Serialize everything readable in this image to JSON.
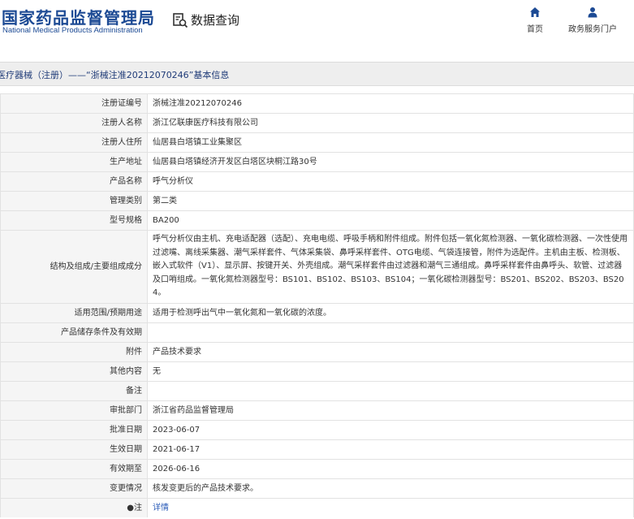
{
  "header": {
    "logo_cn": "国家药品监督管理局",
    "logo_en": "National Medical Products Administration",
    "query_label": "数据查询",
    "nav": [
      {
        "label": "首页",
        "icon": "home-icon"
      },
      {
        "label": "政务服务门户",
        "icon": "user-icon"
      }
    ]
  },
  "title": "医疗器械（注册）——“浙械注准20212070246”基本信息",
  "colors": {
    "brand": "#1c4a94",
    "key_bg": "#f5f5f5",
    "title_bg": "#eeeeee",
    "link": "#2a5bb8"
  },
  "rows": [
    {
      "label": "注册证编号",
      "value": "浙械注准20212070246"
    },
    {
      "label": "注册人名称",
      "value": "浙江亿联康医疗科技有限公司"
    },
    {
      "label": "注册人住所",
      "value": "仙居县白塔镇工业集聚区"
    },
    {
      "label": "生产地址",
      "value": "仙居县白塔镇经济开发区白塔区块桐江路30号"
    },
    {
      "label": "产品名称",
      "value": "呼气分析仪"
    },
    {
      "label": "管理类别",
      "value": "第二类"
    },
    {
      "label": "型号规格",
      "value": "BA200"
    },
    {
      "label": "结构及组成/主要组成成分",
      "value": "呼气分析仪由主机、充电适配器（选配）、充电电缆、呼吸手柄和附件组成。附件包括一氧化氮检测器、一氧化碳检测器、一次性使用过滤嘴、离线采集器、潮气采样套件、气体采集袋、鼻呼采样套件、OTG电缆、气袋连接管，附件为选配件。主机由主板、检测板、嵌入式软件（V1）、显示屏、按键开关、外壳组成。潮气采样套件由过滤器和潮气三通组成。鼻呼采样套件由鼻呼头、软管、过滤器及口哨组成。一氧化氮检测器型号：BS101、BS102、BS103、BS104；一氧化碳检测器型号：BS201、BS202、BS203、BS204。"
    },
    {
      "label": "适用范围/预期用途",
      "value": "适用于检测呼出气中一氧化氮和一氧化碳的浓度。"
    },
    {
      "label": "产品储存条件及有效期",
      "value": ""
    },
    {
      "label": "附件",
      "value": "产品技术要求"
    },
    {
      "label": "其他内容",
      "value": "无"
    },
    {
      "label": "备注",
      "value": ""
    },
    {
      "label": "审批部门",
      "value": "浙江省药品监督管理局"
    },
    {
      "label": "批准日期",
      "value": "2023-06-07"
    },
    {
      "label": "生效日期",
      "value": "2021-06-17"
    },
    {
      "label": "有效期至",
      "value": "2026-06-16"
    },
    {
      "label": "变更情况",
      "value": "核发变更后的产品技术要求。"
    },
    {
      "label": "●注",
      "value": "详情"
    }
  ]
}
